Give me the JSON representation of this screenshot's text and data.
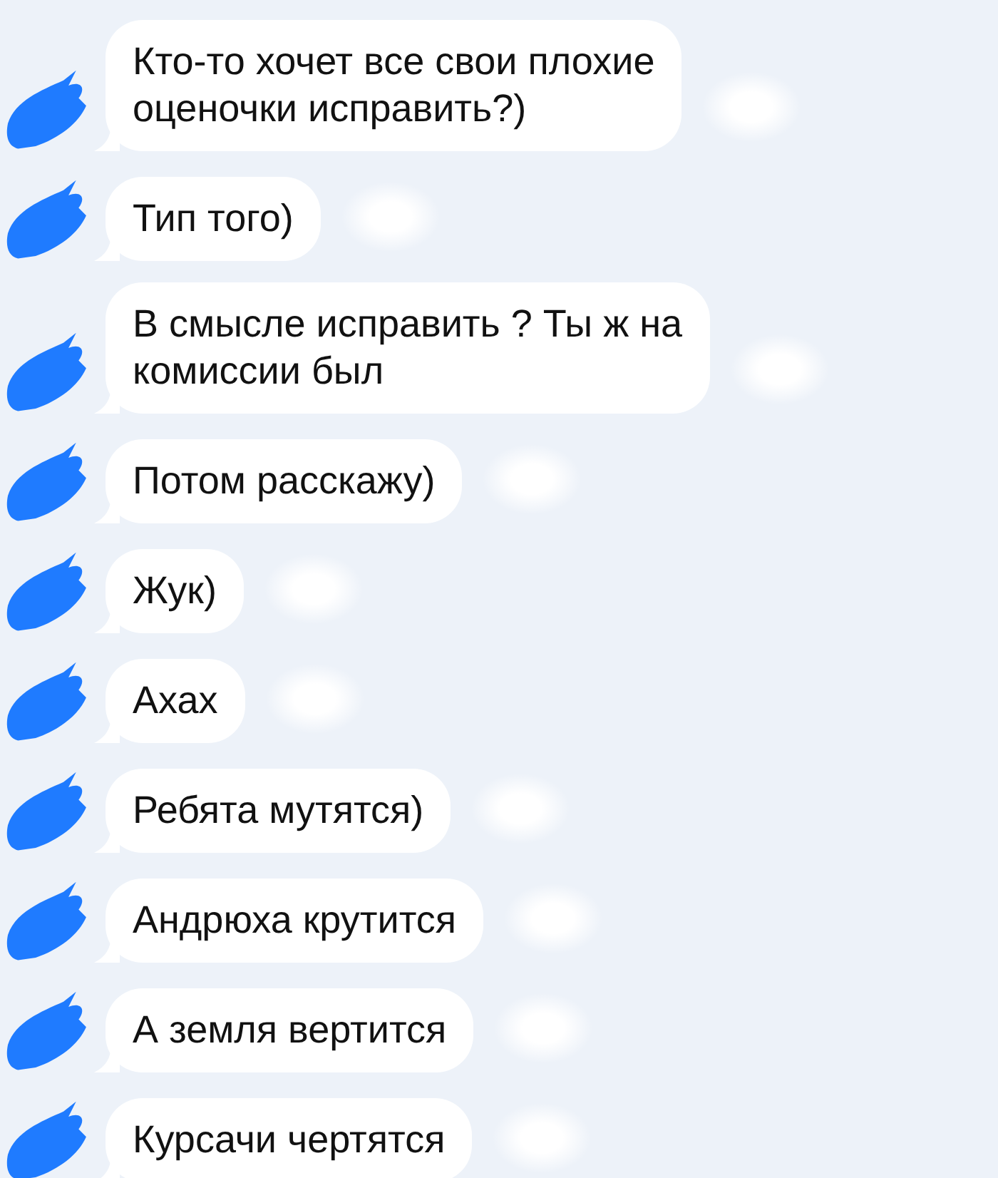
{
  "messages": [
    {
      "text": "Кто-то хочет все свои плохие\nоценочки исправить?)"
    },
    {
      "text": "Тип того)"
    },
    {
      "text": "В смысле исправить ? Ты ж на\nкомиссии был"
    },
    {
      "text": "Потом расскажу)"
    },
    {
      "text": "Жук)"
    },
    {
      "text": "Ахах"
    },
    {
      "text": "Ребята мутятся)"
    },
    {
      "text": "Андрюха крутится"
    },
    {
      "text": "А земля вертится"
    },
    {
      "text": "Курсачи чертятся"
    }
  ]
}
